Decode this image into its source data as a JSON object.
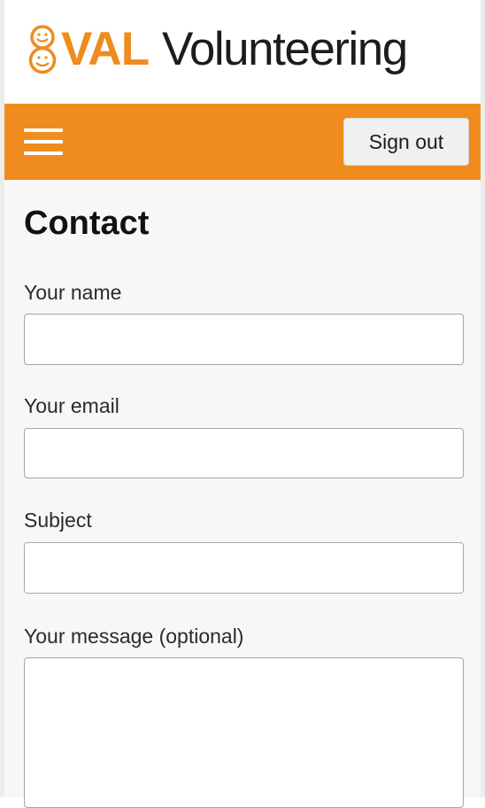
{
  "brand": {
    "logo_val": "VAL",
    "logo_volunteering": "Volunteering",
    "accent_color": "#ef8c1d",
    "icon": "smiley-faces-logo-icon"
  },
  "nav": {
    "menu_icon": "hamburger-menu-icon",
    "sign_out_label": "Sign out"
  },
  "page": {
    "title": "Contact"
  },
  "form": {
    "name_label": "Your name",
    "name_value": "",
    "email_label": "Your email",
    "email_value": "",
    "subject_label": "Subject",
    "subject_value": "",
    "message_label": "Your message (optional)",
    "message_value": ""
  }
}
